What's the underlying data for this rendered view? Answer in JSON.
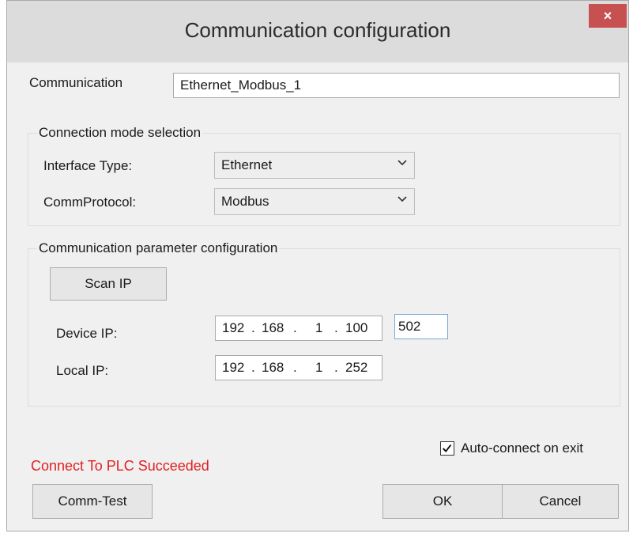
{
  "window": {
    "title": "Communication configuration",
    "close_glyph": "×"
  },
  "communication": {
    "label": "Communication",
    "value": "Ethernet_Modbus_1"
  },
  "connection_mode": {
    "group_title": "Connection mode selection",
    "interface_type_label": "Interface Type:",
    "interface_type_value": "Ethernet",
    "comm_protocol_label": "CommProtocol:",
    "comm_protocol_value": "Modbus"
  },
  "params": {
    "group_title": "Communication parameter configuration",
    "scan_ip_label": "Scan IP",
    "device_ip_label": "Device IP:",
    "device_ip": [
      "192",
      "168",
      "1",
      "100"
    ],
    "port": "502",
    "local_ip_label": "Local IP:",
    "local_ip": [
      "192",
      "168",
      "1",
      "252"
    ],
    "dot": "."
  },
  "footer": {
    "auto_connect_label": "Auto-connect on exit",
    "auto_connect_checked": true,
    "status_text": "Connect To PLC Succeeded",
    "status_color": "#e02020",
    "comm_test_label": "Comm-Test",
    "ok_label": "OK",
    "cancel_label": "Cancel"
  }
}
